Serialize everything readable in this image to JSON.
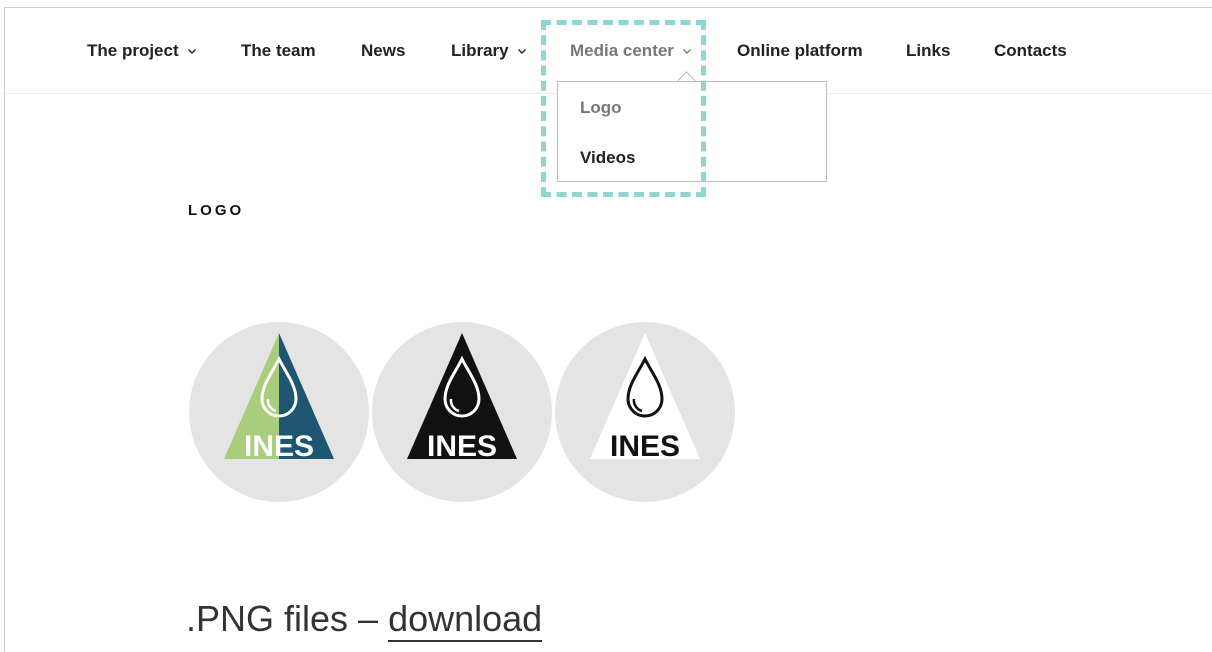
{
  "nav": {
    "items": [
      {
        "label": "The project",
        "has_submenu": true
      },
      {
        "label": "The team",
        "has_submenu": false
      },
      {
        "label": "News",
        "has_submenu": false
      },
      {
        "label": "Library",
        "has_submenu": true
      },
      {
        "label": "Media center",
        "has_submenu": true,
        "active": true
      },
      {
        "label": "Online platform",
        "has_submenu": false
      },
      {
        "label": "Links",
        "has_submenu": false
      },
      {
        "label": "Contacts",
        "has_submenu": false
      }
    ],
    "icon": "chevron-down-icon"
  },
  "dropdown": {
    "items": [
      {
        "label": "Logo",
        "current": true
      },
      {
        "label": "Videos",
        "current": false
      }
    ]
  },
  "highlight_color": "#8fd6d3",
  "section": {
    "title": "LOGO"
  },
  "logos": {
    "text": "INES",
    "variants": [
      {
        "name": "color",
        "colors": [
          "#a8cd7c",
          "#1e5570"
        ]
      },
      {
        "name": "black",
        "colors": [
          "#111111"
        ]
      },
      {
        "name": "white-outline",
        "colors": [
          "#ffffff"
        ]
      }
    ],
    "circle_color": "#e4e4e4"
  },
  "downloads": {
    "prefix": ".PNG files – ",
    "link_text": "download"
  }
}
